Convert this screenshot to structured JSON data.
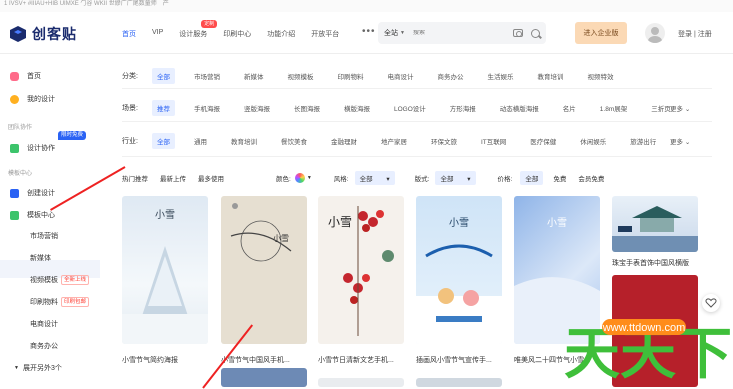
{
  "top_strip": "1 IVSV+ #IIIAU+HIB UIMXE ⼓谷 WKII 世縿广广尾数童师　产",
  "logo": {
    "text": "创客贴"
  },
  "nav": {
    "items": [
      {
        "label": "首页",
        "active": true
      },
      {
        "label": "VIP"
      },
      {
        "label": "设计服务",
        "badge": "定制"
      },
      {
        "label": "印刷中心"
      },
      {
        "label": "功能介绍"
      },
      {
        "label": "开放平台"
      }
    ],
    "more": "•••"
  },
  "search": {
    "scope": "全站",
    "placeholder": "搜索"
  },
  "header_actions": {
    "enterprise": "进入企业版",
    "login": "登录 | 注册"
  },
  "sidebar": {
    "items": [
      {
        "label": "首页",
        "icon": "home-icon",
        "color": "#ff6b8a"
      },
      {
        "label": "我的设计",
        "icon": "trophy-icon",
        "color": "#ffb020"
      }
    ],
    "section1": "团队协作",
    "team": {
      "label": "设计协作",
      "icon": "team-icon",
      "color": "#3cc46b",
      "badge": "限时免费"
    },
    "section2": "模板中心",
    "create": {
      "label": "创建设计",
      "icon": "plus-icon",
      "color": "#2a62f4"
    },
    "templates": {
      "label": "模板中心",
      "icon": "template-icon",
      "color": "#3cc46b"
    },
    "sub_items": [
      {
        "label": "市场营销"
      },
      {
        "label": "新媒体"
      },
      {
        "label": "视频模板",
        "tag": "全新上线"
      },
      {
        "label": "印刷物料",
        "tag": "印刷包邮"
      },
      {
        "label": "电商设计"
      },
      {
        "label": "商务办公"
      }
    ],
    "expand": "展开另外3个"
  },
  "filters": {
    "category": {
      "label": "分类:",
      "options": [
        "全部",
        "市场营销",
        "新媒体",
        "视频模板",
        "印刷物料",
        "电商设计",
        "商务办公",
        "生活娱乐",
        "教育培训",
        "视频特效"
      ],
      "selected": 0
    },
    "scene": {
      "label": "场景:",
      "options": [
        "推荐",
        "手机海报",
        "竖版海报",
        "长图海报",
        "横版海报",
        "LOGO设计",
        "方形海报",
        "动态横版海报",
        "名片",
        "1.8m展架",
        "三折页"
      ],
      "selected": 0,
      "more": "更多"
    },
    "industry": {
      "label": "行业:",
      "options": [
        "全部",
        "通用",
        "教育培训",
        "餐饮美食",
        "金融理财",
        "地产家居",
        "环保文旅",
        "IT互联网",
        "医疗保健",
        "休闲娱乐",
        "旅游出行"
      ],
      "selected": 0,
      "more": "更多"
    }
  },
  "toolbar": {
    "sort": [
      "热门推荐",
      "最新上传",
      "最多使用"
    ],
    "color_label": "颜色:",
    "style_label": "风格:",
    "style_value": "全部",
    "layout_label": "版式:",
    "layout_value": "全部",
    "price_label": "价格:",
    "price_options": [
      "全部",
      "免费",
      "会员免费"
    ]
  },
  "cards": [
    {
      "title": "小雪节气简约海报",
      "art": "小雪"
    },
    {
      "title": "小雪节气中国风手机...",
      "art": "小雪"
    },
    {
      "title": "小雪节日清新文艺手机...",
      "art": "小雪"
    },
    {
      "title": "插画风小雪节气宣传手...",
      "art": "小雪"
    },
    {
      "title": "唯美风二十四节气小雪...",
      "art": "小雪"
    },
    {
      "title": "珠宝手表首饰中国风横版",
      "art": ""
    }
  ],
  "watermark": {
    "text": "天天下载",
    "url": "www.ttdown.com"
  },
  "colors": {
    "accent": "#2a62f4",
    "arrow": "#e22222"
  }
}
